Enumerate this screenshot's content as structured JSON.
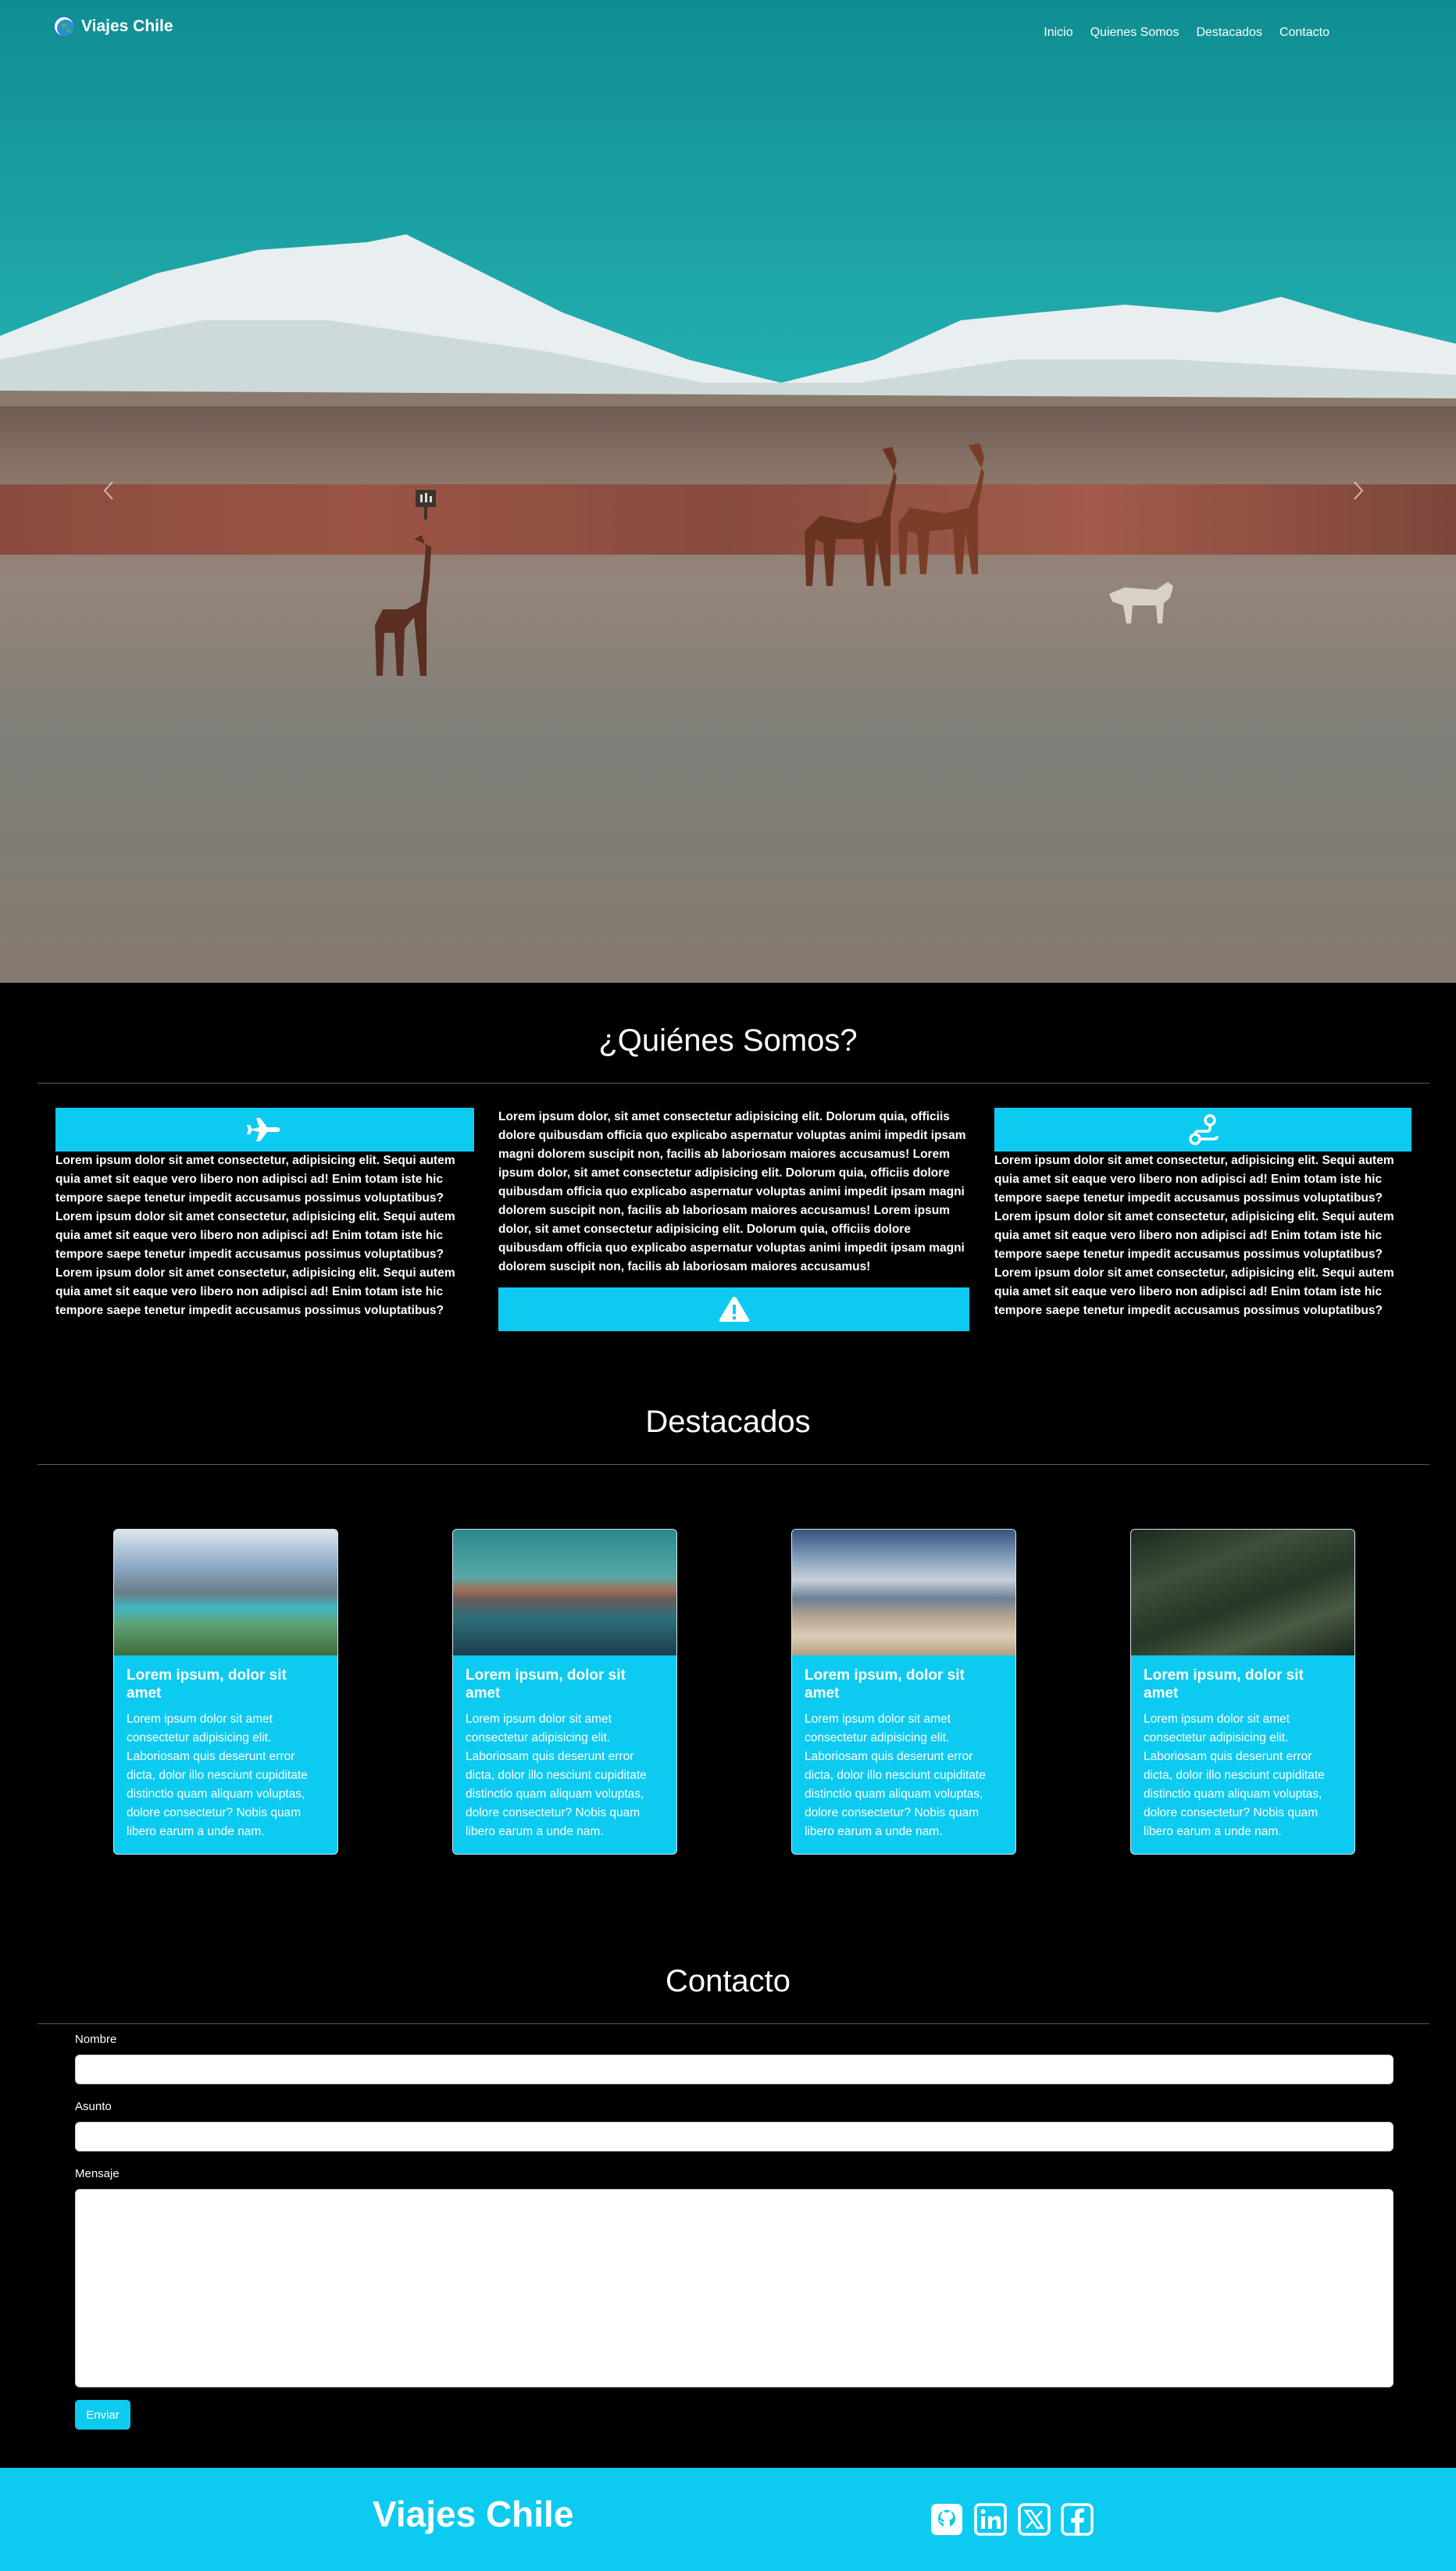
{
  "nav": {
    "brand": "Viajes Chile",
    "links": [
      "Inicio",
      "Quienes Somos",
      "Destacados",
      "Contacto"
    ]
  },
  "about": {
    "title": "¿Quiénes Somos?",
    "left_text": "Lorem ipsum dolor sit amet consectetur, adipisicing elit. Sequi autem quia amet sit eaque vero libero non adipisci ad! Enim totam iste hic tempore saepe tenetur impedit accusamus possimus voluptatibus? Lorem ipsum dolor sit amet consectetur, adipisicing elit. Sequi autem quia amet sit eaque vero libero non adipisci ad! Enim totam iste hic tempore saepe tenetur impedit accusamus possimus voluptatibus? Lorem ipsum dolor sit amet consectetur, adipisicing elit. Sequi autem quia amet sit eaque vero libero non adipisci ad! Enim totam iste hic tempore saepe tenetur impedit accusamus possimus voluptatibus?",
    "center_text": "Lorem ipsum dolor, sit amet consectetur adipisicing elit. Dolorum quia, officiis dolore quibusdam officia quo explicabo aspernatur voluptas animi impedit ipsam magni dolorem suscipit non, facilis ab laboriosam maiores accusamus! Lorem ipsum dolor, sit amet consectetur adipisicing elit. Dolorum quia, officiis dolore quibusdam officia quo explicabo aspernatur voluptas animi impedit ipsam magni dolorem suscipit non, facilis ab laboriosam maiores accusamus! Lorem ipsum dolor, sit amet consectetur adipisicing elit. Dolorum quia, officiis dolore quibusdam officia quo explicabo aspernatur voluptas animi impedit ipsam magni dolorem suscipit non, facilis ab laboriosam maiores accusamus!",
    "right_text": "Lorem ipsum dolor sit amet consectetur, adipisicing elit. Sequi autem quia amet sit eaque vero libero non adipisci ad! Enim totam iste hic tempore saepe tenetur impedit accusamus possimus voluptatibus? Lorem ipsum dolor sit amet consectetur, adipisicing elit. Sequi autem quia amet sit eaque vero libero non adipisci ad! Enim totam iste hic tempore saepe tenetur impedit accusamus possimus voluptatibus? Lorem ipsum dolor sit amet consectetur, adipisicing elit. Sequi autem quia amet sit eaque vero libero non adipisci ad! Enim totam iste hic tempore saepe tenetur impedit accusamus possimus voluptatibus?",
    "icons": [
      "airplane-icon",
      "warning-icon",
      "route-icon"
    ]
  },
  "featured": {
    "title": "Destacados",
    "cards": [
      {
        "title": "Lorem ipsum, dolor sit amet",
        "text": "Lorem ipsum dolor sit amet consectetur adipisicing elit. Laboriosam quis deserunt error dicta, dolor illo nesciunt cupiditate distinctio quam aliquam voluptas, dolore consectetur? Nobis quam libero earum a unde nam."
      },
      {
        "title": "Lorem ipsum, dolor sit amet",
        "text": "Lorem ipsum dolor sit amet consectetur adipisicing elit. Laboriosam quis deserunt error dicta, dolor illo nesciunt cupiditate distinctio quam aliquam voluptas, dolore consectetur? Nobis quam libero earum a unde nam."
      },
      {
        "title": "Lorem ipsum, dolor sit amet",
        "text": "Lorem ipsum dolor sit amet consectetur adipisicing elit. Laboriosam quis deserunt error dicta, dolor illo nesciunt cupiditate distinctio quam aliquam voluptas, dolore consectetur? Nobis quam libero earum a unde nam."
      },
      {
        "title": "Lorem ipsum, dolor sit amet",
        "text": "Lorem ipsum dolor sit amet consectetur adipisicing elit. Laboriosam quis deserunt error dicta, dolor illo nesciunt cupiditate distinctio quam aliquam voluptas, dolore consectetur? Nobis quam libero earum a unde nam."
      }
    ]
  },
  "contact": {
    "title": "Contacto",
    "name_label": "Nombre",
    "subject_label": "Asunto",
    "message_label": "Mensaje",
    "submit_label": "Enviar"
  },
  "footer": {
    "brand": "Viajes Chile",
    "social": [
      "github-icon",
      "linkedin-icon",
      "x-twitter-icon",
      "facebook-icon"
    ]
  },
  "colors": {
    "accent": "#0dcaf0",
    "background": "#000000"
  }
}
